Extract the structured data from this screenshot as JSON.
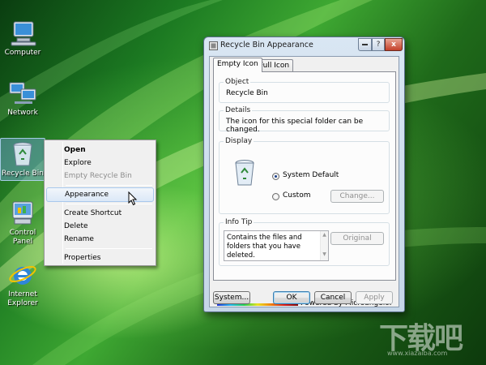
{
  "desktop": {
    "icons": [
      {
        "label": "Computer",
        "icon": "computer-icon"
      },
      {
        "label": "Network",
        "icon": "network-icon"
      },
      {
        "label": "Recycle Bin",
        "icon": "recycle-bin-icon"
      },
      {
        "label": "Control\nPanel",
        "icon": "control-panel-icon"
      },
      {
        "label": "Internet\nExplorer",
        "icon": "internet-explorer-icon"
      }
    ]
  },
  "context_menu": {
    "items": [
      {
        "label": "Open",
        "bold": true
      },
      {
        "label": "Explore"
      },
      {
        "label": "Empty Recycle Bin",
        "disabled": true
      },
      {
        "label": "Appearance",
        "hover": true
      },
      {
        "label": "Create Shortcut"
      },
      {
        "label": "Delete"
      },
      {
        "label": "Rename"
      },
      {
        "label": "Properties"
      }
    ]
  },
  "window": {
    "title": "Recycle Bin Appearance",
    "caption_buttons": {
      "help": "?",
      "close": "x"
    },
    "tabs": [
      {
        "label": "Empty Icon",
        "active": true
      },
      {
        "label": "Full Icon",
        "active": false
      }
    ],
    "object": {
      "label": "Object",
      "value": "Recycle Bin"
    },
    "details": {
      "label": "Details",
      "value": "The icon for this special folder can be changed."
    },
    "display": {
      "label": "Display",
      "system_default": "System Default",
      "custom": "Custom",
      "change_button": "Change...",
      "selected": "system_default"
    },
    "info_tip": {
      "label": "Info Tip",
      "text": "Contains the files and folders that you have deleted.",
      "original_button": "Original"
    },
    "powered_by": "Powered by Microangelo.",
    "buttons": {
      "system": "System...",
      "ok": "OK",
      "cancel": "Cancel",
      "apply": "Apply"
    }
  },
  "colors": {
    "accent": "#1a3f8a",
    "desktop_green": "#2e8b2a"
  }
}
